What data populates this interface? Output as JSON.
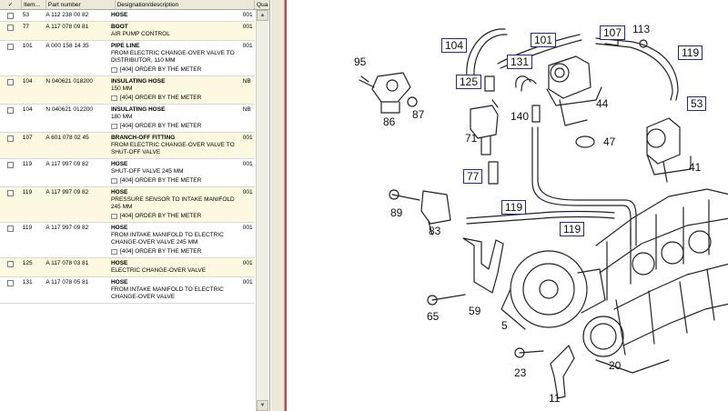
{
  "table": {
    "headers": {
      "check": "✓",
      "item": "Item...",
      "part": "Part number",
      "desc": "Designation/description",
      "qty": "Qua"
    },
    "rows": [
      {
        "item": "53",
        "part": "A 112 238 00 82",
        "title": "HOSE",
        "lines": [],
        "order": "",
        "qty": "001"
      },
      {
        "item": "77",
        "part": "A 117 078 09 81",
        "title": "BOOT",
        "lines": [
          "AIR PUMP CONTROL"
        ],
        "order": "",
        "qty": "001"
      },
      {
        "item": "101",
        "part": "A 000 158 14 35",
        "title": "PIPE LINE",
        "lines": [
          "FROM ELECTRIC CHANGE-OVER VALVE TO",
          "DISTRIBUTOR, 110 MM"
        ],
        "order": "[404] ORDER BY THE METER",
        "qty": "001"
      },
      {
        "item": "104",
        "part": "N 040621 018200",
        "title": "INSULATING HOSE",
        "lines": [
          "150 MM"
        ],
        "order": "[404] ORDER BY THE METER",
        "qty": "NB"
      },
      {
        "item": "104",
        "part": "N 040621 012200",
        "title": "INSULATING HOSE",
        "lines": [
          "180 MM"
        ],
        "order": "[404] ORDER BY THE METER",
        "qty": "NB"
      },
      {
        "item": "107",
        "part": "A 601 078 02 45",
        "title": "BRANCH-OFF FITTING",
        "lines": [
          "FROM ELECTRIC CHANGE-OVER VALVE TO",
          "SHUT-OFF VALVE"
        ],
        "order": "",
        "qty": "001"
      },
      {
        "item": "119",
        "part": "A 117 997 09 82",
        "title": "HOSE",
        "lines": [
          "SHUT-OFF VALVE 245 MM"
        ],
        "order": "[404] ORDER BY THE METER",
        "qty": "001"
      },
      {
        "item": "119",
        "part": "A 117 997 09 82",
        "title": "HOSE",
        "lines": [
          "PRESSURE SENSOR TO INTAKE MANIFOLD",
          "245 MM"
        ],
        "order": "[404] ORDER BY THE METER",
        "qty": "001"
      },
      {
        "item": "119",
        "part": "A 117 997 09 82",
        "title": "HOSE",
        "lines": [
          "FROM INTAKE MANIFOLD TO ELECTRIC",
          "CHANGE-OVER VALVE 245 MM"
        ],
        "order": "[404] ORDER BY THE METER",
        "qty": "001"
      },
      {
        "item": "125",
        "part": "A 117 078 03 81",
        "title": "HOSE",
        "lines": [
          "ELECTRIC CHANGE-OVER VALVE"
        ],
        "order": "",
        "qty": "001"
      },
      {
        "item": "131",
        "part": "A 117 078 05 81",
        "title": "HOSE",
        "lines": [
          "FROM INTAKE MANIFOLD TO ELECTRIC",
          "CHANGE-OVER VALVE"
        ],
        "order": "",
        "qty": "001"
      }
    ]
  },
  "scrollbar": {
    "up": "▲",
    "down": "▼"
  },
  "diagram": {
    "callouts": {
      "c95": "95",
      "c86": "86",
      "c87": "87",
      "c104": "104",
      "c101": "101",
      "c107": "107",
      "c113": "113",
      "c119a": "119",
      "c131": "131",
      "c125": "125",
      "c44": "44",
      "c53": "53",
      "c140": "140",
      "c71": "71",
      "c47": "47",
      "c41": "41",
      "c77": "77",
      "c89": "89",
      "c119b": "119",
      "c119c": "119",
      "c83": "83",
      "c65": "65",
      "c59": "59",
      "c5": "5",
      "c20": "20",
      "c23": "23",
      "c11": "11"
    }
  }
}
